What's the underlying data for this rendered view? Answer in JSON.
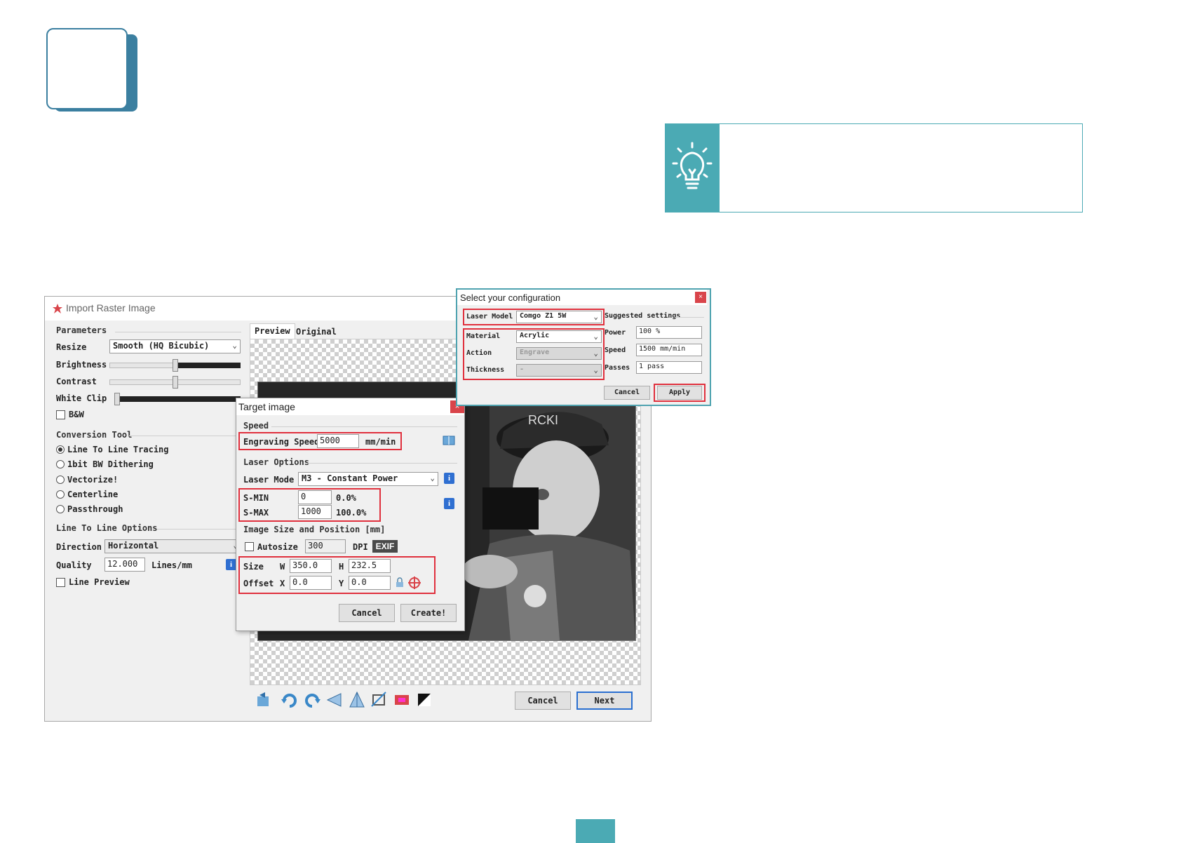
{
  "main_window": {
    "title": "Import Raster Image",
    "parameters_group": "Parameters",
    "resize_label": "Resize",
    "resize_value": "Smooth (HQ Bicubic)",
    "brightness_label": "Brightness",
    "contrast_label": "Contrast",
    "white_clip_label": "White Clip",
    "bw_label": "B&W",
    "conversion_group": "Conversion Tool",
    "conversion_options": [
      "Line To Line Tracing",
      "1bit BW Dithering",
      "Vectorize!",
      "Centerline",
      "Passthrough"
    ],
    "conversion_selected": 0,
    "l2l_group": "Line To Line Options",
    "direction_label": "Direction",
    "direction_value": "Horizontal",
    "quality_label": "Quality",
    "quality_value": "12.000",
    "quality_unit": "Lines/mm",
    "line_preview_label": "Line Preview",
    "tabs": [
      "Preview",
      "Original"
    ],
    "cancel_label": "Cancel",
    "next_label": "Next"
  },
  "target_dialog": {
    "title": "Target image",
    "close": "×",
    "speed_group": "Speed",
    "engraving_speed_label": "Engraving Speed",
    "engraving_speed_value": "5000",
    "engraving_speed_unit": "mm/min",
    "laser_options_group": "Laser Options",
    "laser_mode_label": "Laser Mode",
    "laser_mode_value": "M3 - Constant Power",
    "smin_label": "S-MIN",
    "smin_value": "0",
    "smin_pct": "0.0%",
    "smax_label": "S-MAX",
    "smax_value": "1000",
    "smax_pct": "100.0%",
    "image_size_group": "Image Size and Position [mm]",
    "autosize_label": "Autosize",
    "dpi_value": "300",
    "dpi_label": "DPI",
    "exif_label": "EXIF",
    "size_label": "Size",
    "w_label": "W",
    "w_value": "350.0",
    "h_label": "H",
    "h_value": "232.5",
    "offset_label": "Offset",
    "x_label": "X",
    "x_value": "0.0",
    "y_label": "Y",
    "y_value": "0.0",
    "cancel_label": "Cancel",
    "create_label": "Create!"
  },
  "config_dialog": {
    "title": "Select your configuration",
    "close": "×",
    "laser_model_label": "Laser Model",
    "laser_model_value": "Comgo Z1 5W",
    "material_label": "Material",
    "material_value": "Acrylic",
    "action_label": "Action",
    "action_value": "Engrave",
    "thickness_label": "Thickness",
    "thickness_value": "-",
    "suggested_group": "Suggested settings",
    "power_label": "Power",
    "power_value": "100 %",
    "speed_label": "Speed",
    "speed_value": "1500 mm/min",
    "passes_label": "Passes",
    "passes_value": "1 pass",
    "cancel_label": "Cancel",
    "apply_label": "Apply"
  },
  "colors": {
    "accent_teal": "#4baab4",
    "step_blue": "#3b7fa0",
    "highlight_red": "#e0303d",
    "info_blue": "#2f6fd1"
  },
  "icons": [
    "lightbulb-icon",
    "laser-logo-icon",
    "reset-icon",
    "rotate-ccw-icon",
    "rotate-cw-icon",
    "flip-horizontal-icon",
    "flip-vertical-icon",
    "crop-icon",
    "auto-crop-icon",
    "invert-icon",
    "info-icon",
    "center-icon",
    "lock-icon"
  ]
}
